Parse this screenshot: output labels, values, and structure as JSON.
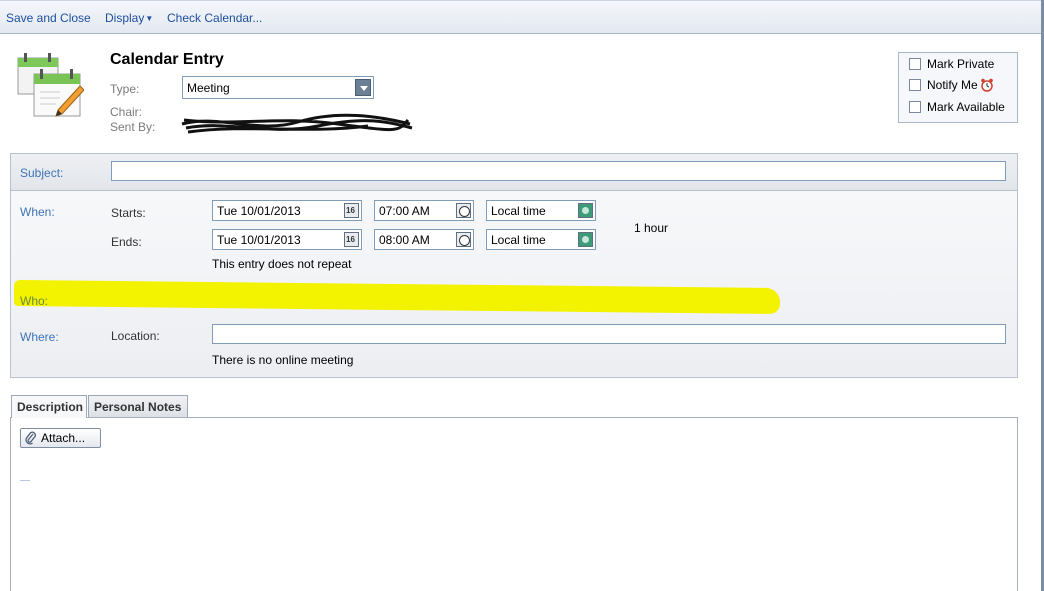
{
  "toolbar": {
    "save_close": "Save and Close",
    "display": "Display",
    "check_calendar": "Check Calendar..."
  },
  "header": {
    "title": "Calendar Entry",
    "type_label": "Type:",
    "type_value": "Meeting",
    "chair_label": "Chair:",
    "sent_by_label": "Sent By:"
  },
  "options": {
    "mark_private": "Mark Private",
    "notify_me": "Notify Me",
    "mark_available": "Mark Available"
  },
  "subject": {
    "label": "Subject:",
    "value": ""
  },
  "when": {
    "label": "When:",
    "starts_label": "Starts:",
    "ends_label": "Ends:",
    "start_date": "Tue 10/01/2013",
    "start_time": "07:00 AM",
    "start_tz": "Local time",
    "end_date": "Tue 10/01/2013",
    "end_time": "08:00 AM",
    "end_tz": "Local time",
    "duration": "1 hour",
    "repeat_text": "This entry does not repeat"
  },
  "who": {
    "label": "Who:"
  },
  "where": {
    "label": "Where:",
    "location_label": "Location:",
    "location_value": "",
    "online_text": "There is no online meeting"
  },
  "tabs": [
    {
      "label": "Description"
    },
    {
      "label": "Personal Notes"
    }
  ],
  "description": {
    "attach_label": "Attach..."
  },
  "colors": {
    "link_blue": "#1e4e9c",
    "label_blue": "#3f74b6",
    "highlight": "#f3f300"
  }
}
